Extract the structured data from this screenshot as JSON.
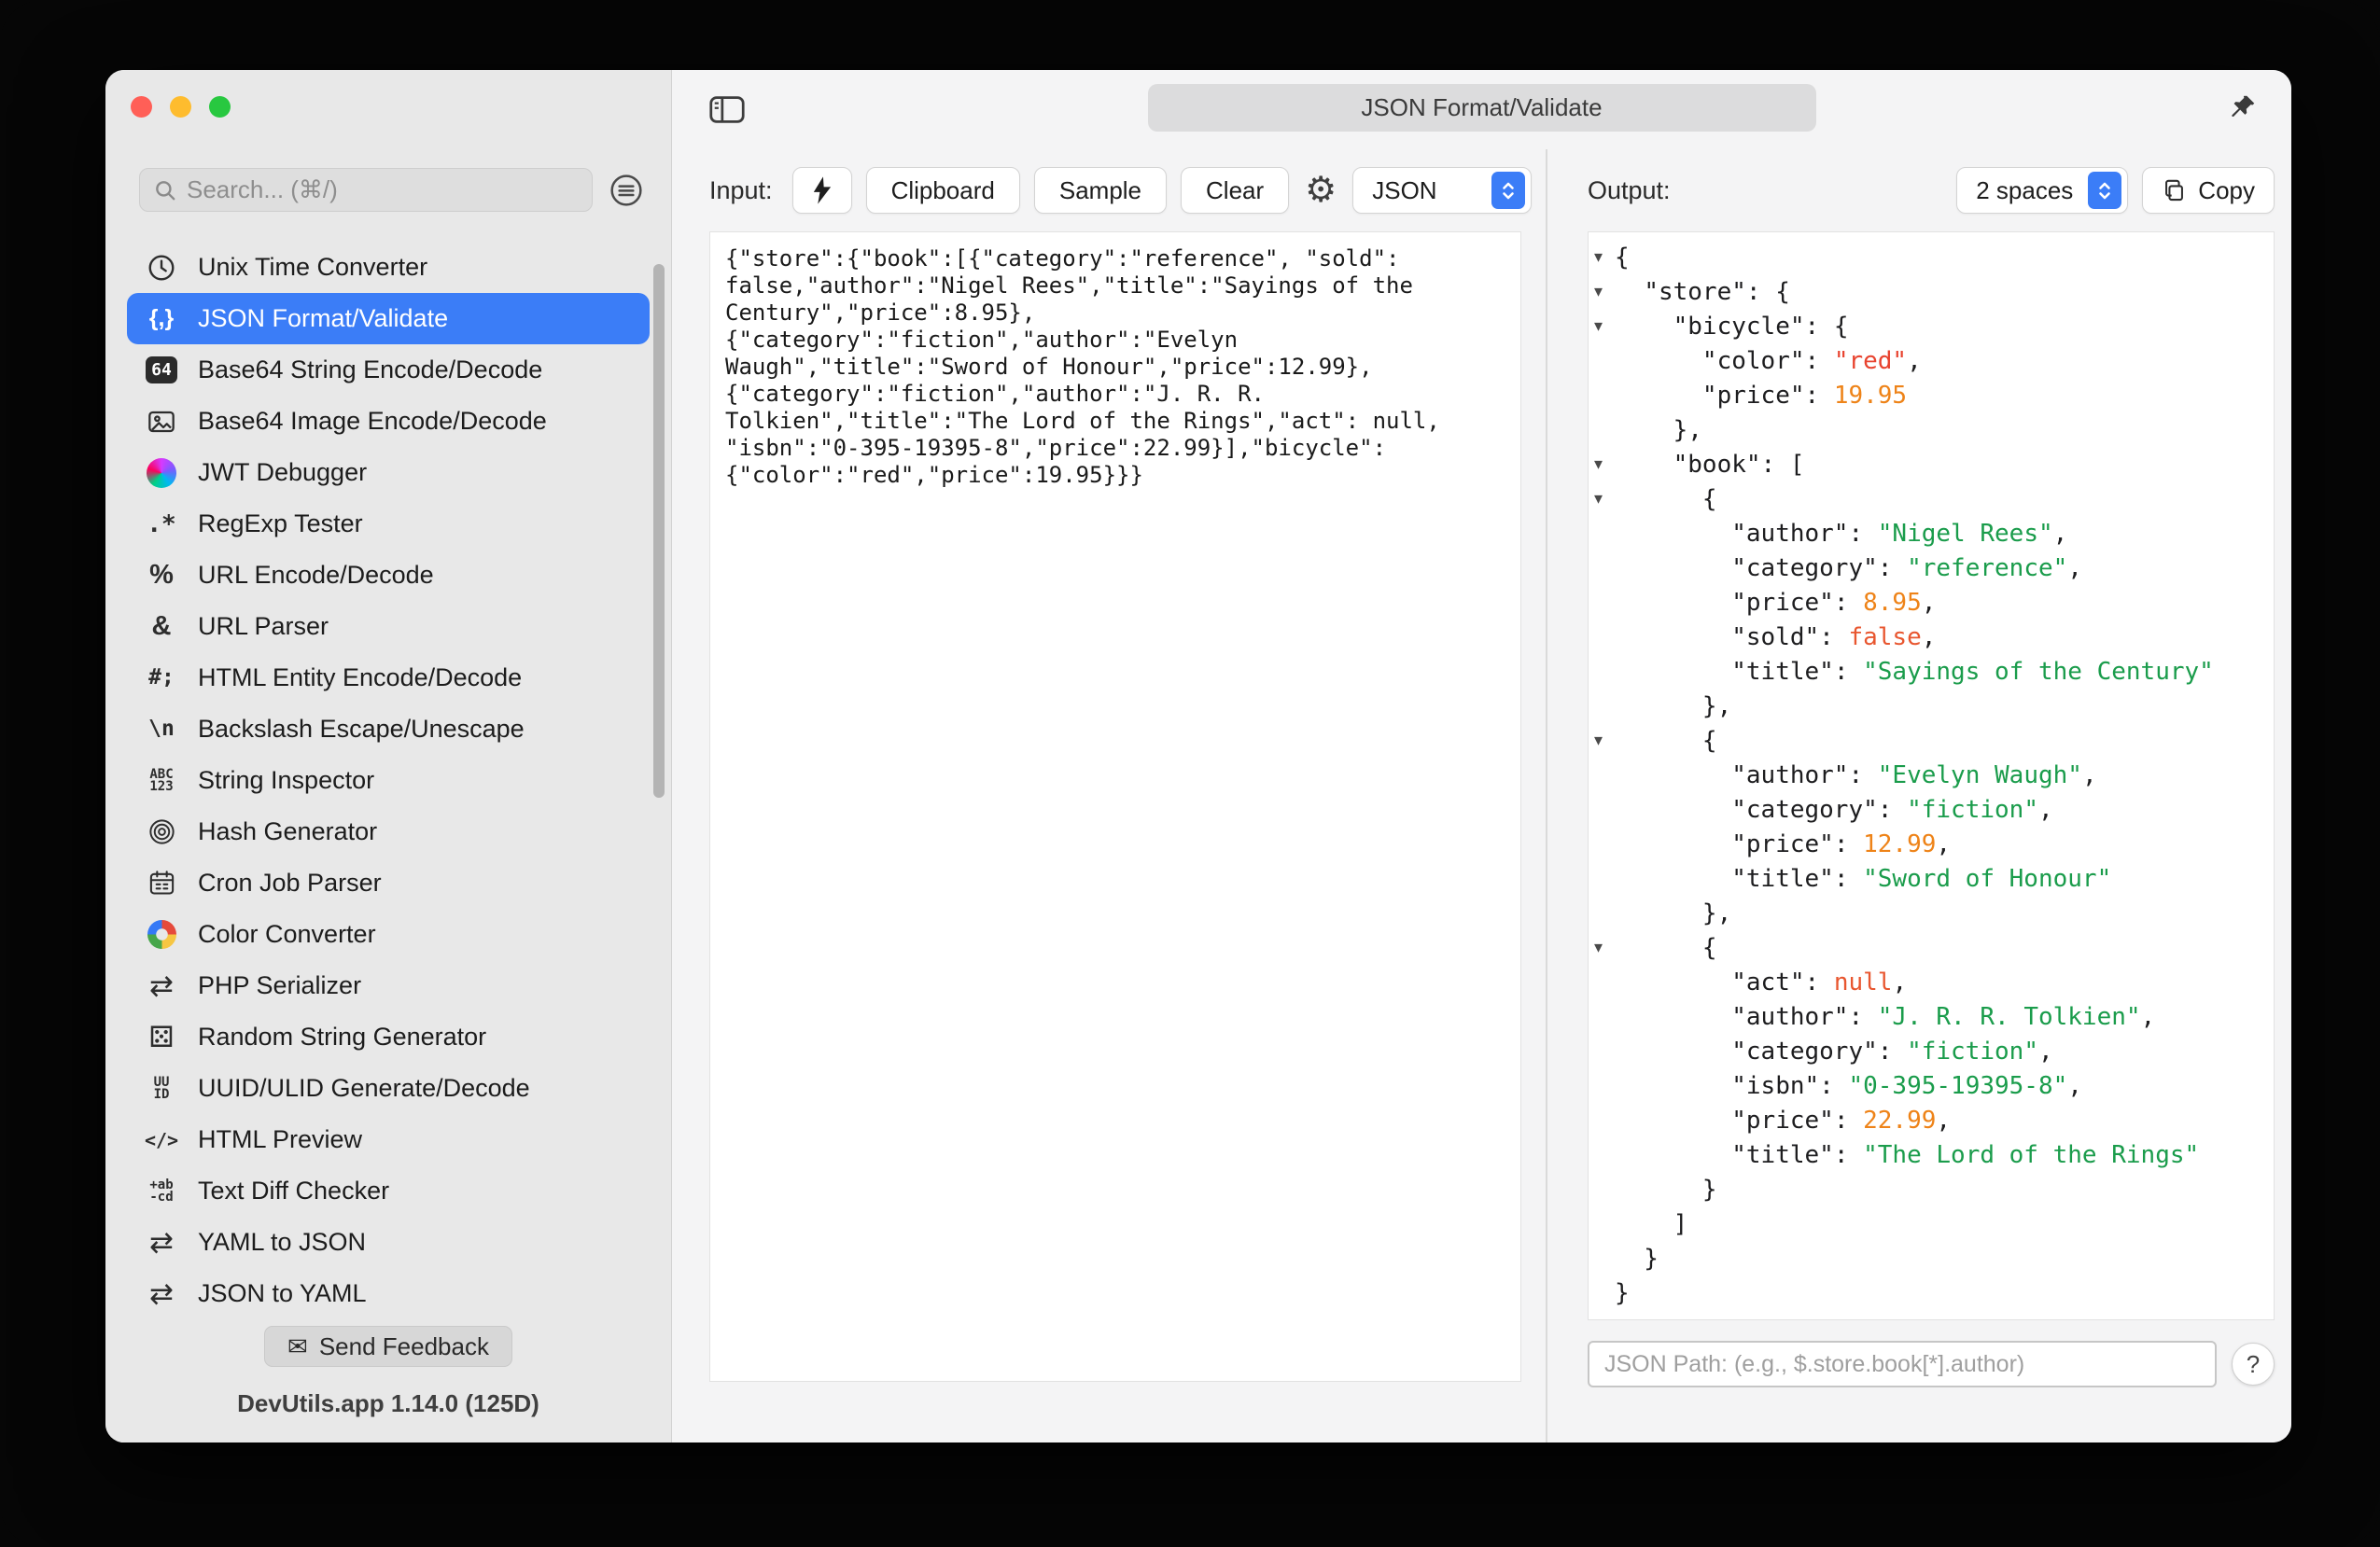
{
  "window": {
    "tab_title": "JSON Format/Validate"
  },
  "sidebar": {
    "search": {
      "placeholder": "Search... (⌘/)"
    },
    "items": [
      {
        "label": "Unix Time Converter",
        "icon": "clock",
        "selected": false
      },
      {
        "label": "JSON Format/Validate",
        "icon": "json-braces",
        "selected": true
      },
      {
        "label": "Base64 String Encode/Decode",
        "icon": "base64",
        "selected": false
      },
      {
        "label": "Base64 Image Encode/Decode",
        "icon": "image",
        "selected": false
      },
      {
        "label": "JWT Debugger",
        "icon": "jwt",
        "selected": false
      },
      {
        "label": "RegExp Tester",
        "icon": "regexp",
        "selected": false
      },
      {
        "label": "URL Encode/Decode",
        "icon": "percent",
        "selected": false
      },
      {
        "label": "URL Parser",
        "icon": "ampersand",
        "selected": false
      },
      {
        "label": "HTML Entity Encode/Decode",
        "icon": "entity",
        "selected": false
      },
      {
        "label": "Backslash Escape/Unescape",
        "icon": "backslash",
        "selected": false
      },
      {
        "label": "String Inspector",
        "icon": "string-inspector",
        "selected": false
      },
      {
        "label": "Hash Generator",
        "icon": "fingerprint",
        "selected": false
      },
      {
        "label": "Cron Job Parser",
        "icon": "calendar",
        "selected": false
      },
      {
        "label": "Color Converter",
        "icon": "palette",
        "selected": false
      },
      {
        "label": "PHP Serializer",
        "icon": "swap",
        "selected": false
      },
      {
        "label": "Random String Generator",
        "icon": "dice",
        "selected": false
      },
      {
        "label": "UUID/ULID Generate/Decode",
        "icon": "uuid",
        "selected": false
      },
      {
        "label": "HTML Preview",
        "icon": "code",
        "selected": false
      },
      {
        "label": "Text Diff Checker",
        "icon": "diff",
        "selected": false
      },
      {
        "label": "YAML to JSON",
        "icon": "swap",
        "selected": false
      },
      {
        "label": "JSON to YAML",
        "icon": "swap",
        "selected": false
      }
    ],
    "feedback_button": "Send Feedback",
    "version": "DevUtils.app 1.14.0 (125D)"
  },
  "input_panel": {
    "label": "Input:",
    "clipboard_button": "Clipboard",
    "sample_button": "Sample",
    "clear_button": "Clear",
    "format_select_value": "JSON",
    "content": "{\"store\":{\"book\":[{\"category\":\"reference\", \"sold\": false,\"author\":\"Nigel Rees\",\"title\":\"Sayings of the Century\",\"price\":8.95},\n{\"category\":\"fiction\",\"author\":\"Evelyn Waugh\",\"title\":\"Sword of Honour\",\"price\":12.99},\n{\"category\":\"fiction\",\"author\":\"J. R. R. Tolkien\",\"title\":\"The Lord of the Rings\",\"act\": null, \"isbn\":\"0-395-19395-8\",\"price\":22.99}],\"bicycle\":{\"color\":\"red\",\"price\":19.95}}}"
  },
  "output_panel": {
    "label": "Output:",
    "indent_select_value": "2 spaces",
    "copy_button": "Copy",
    "json_path_placeholder": "JSON Path: (e.g., $.store.book[*].author)",
    "help_button": "?",
    "lines": [
      {
        "f": true,
        "t": [
          [
            "p",
            "{"
          ]
        ]
      },
      {
        "f": true,
        "t": [
          [
            "p",
            "  "
          ],
          [
            "k",
            "\"store\""
          ],
          [
            "p",
            ": {"
          ]
        ]
      },
      {
        "f": true,
        "t": [
          [
            "p",
            "    "
          ],
          [
            "k",
            "\"bicycle\""
          ],
          [
            "p",
            ": {"
          ]
        ]
      },
      {
        "f": false,
        "t": [
          [
            "p",
            "      "
          ],
          [
            "k",
            "\"color\""
          ],
          [
            "p",
            ": "
          ],
          [
            "r",
            "\"red\""
          ],
          [
            "p",
            ","
          ]
        ]
      },
      {
        "f": false,
        "t": [
          [
            "p",
            "      "
          ],
          [
            "k",
            "\"price\""
          ],
          [
            "p",
            ": "
          ],
          [
            "n",
            "19.95"
          ]
        ]
      },
      {
        "f": false,
        "t": [
          [
            "p",
            "    },"
          ]
        ]
      },
      {
        "f": true,
        "t": [
          [
            "p",
            "    "
          ],
          [
            "k",
            "\"book\""
          ],
          [
            "p",
            ": ["
          ]
        ]
      },
      {
        "f": true,
        "t": [
          [
            "p",
            "      {"
          ]
        ]
      },
      {
        "f": false,
        "t": [
          [
            "p",
            "        "
          ],
          [
            "k",
            "\"author\""
          ],
          [
            "p",
            ": "
          ],
          [
            "s",
            "\"Nigel Rees\""
          ],
          [
            "p",
            ","
          ]
        ]
      },
      {
        "f": false,
        "t": [
          [
            "p",
            "        "
          ],
          [
            "k",
            "\"category\""
          ],
          [
            "p",
            ": "
          ],
          [
            "s",
            "\"reference\""
          ],
          [
            "p",
            ","
          ]
        ]
      },
      {
        "f": false,
        "t": [
          [
            "p",
            "        "
          ],
          [
            "k",
            "\"price\""
          ],
          [
            "p",
            ": "
          ],
          [
            "n",
            "8.95"
          ],
          [
            "p",
            ","
          ]
        ]
      },
      {
        "f": false,
        "t": [
          [
            "p",
            "        "
          ],
          [
            "k",
            "\"sold\""
          ],
          [
            "p",
            ": "
          ],
          [
            "b",
            "false"
          ],
          [
            "p",
            ","
          ]
        ]
      },
      {
        "f": false,
        "t": [
          [
            "p",
            "        "
          ],
          [
            "k",
            "\"title\""
          ],
          [
            "p",
            ": "
          ],
          [
            "s",
            "\"Sayings of the Century\""
          ]
        ]
      },
      {
        "f": false,
        "t": [
          [
            "p",
            "      },"
          ]
        ]
      },
      {
        "f": true,
        "t": [
          [
            "p",
            "      {"
          ]
        ]
      },
      {
        "f": false,
        "t": [
          [
            "p",
            "        "
          ],
          [
            "k",
            "\"author\""
          ],
          [
            "p",
            ": "
          ],
          [
            "s",
            "\"Evelyn Waugh\""
          ],
          [
            "p",
            ","
          ]
        ]
      },
      {
        "f": false,
        "t": [
          [
            "p",
            "        "
          ],
          [
            "k",
            "\"category\""
          ],
          [
            "p",
            ": "
          ],
          [
            "s",
            "\"fiction\""
          ],
          [
            "p",
            ","
          ]
        ]
      },
      {
        "f": false,
        "t": [
          [
            "p",
            "        "
          ],
          [
            "k",
            "\"price\""
          ],
          [
            "p",
            ": "
          ],
          [
            "n",
            "12.99"
          ],
          [
            "p",
            ","
          ]
        ]
      },
      {
        "f": false,
        "t": [
          [
            "p",
            "        "
          ],
          [
            "k",
            "\"title\""
          ],
          [
            "p",
            ": "
          ],
          [
            "s",
            "\"Sword of Honour\""
          ]
        ]
      },
      {
        "f": false,
        "t": [
          [
            "p",
            "      },"
          ]
        ]
      },
      {
        "f": true,
        "t": [
          [
            "p",
            "      {"
          ]
        ]
      },
      {
        "f": false,
        "t": [
          [
            "p",
            "        "
          ],
          [
            "k",
            "\"act\""
          ],
          [
            "p",
            ": "
          ],
          [
            "b",
            "null"
          ],
          [
            "p",
            ","
          ]
        ]
      },
      {
        "f": false,
        "t": [
          [
            "p",
            "        "
          ],
          [
            "k",
            "\"author\""
          ],
          [
            "p",
            ": "
          ],
          [
            "s",
            "\"J. R. R. Tolkien\""
          ],
          [
            "p",
            ","
          ]
        ]
      },
      {
        "f": false,
        "t": [
          [
            "p",
            "        "
          ],
          [
            "k",
            "\"category\""
          ],
          [
            "p",
            ": "
          ],
          [
            "s",
            "\"fiction\""
          ],
          [
            "p",
            ","
          ]
        ]
      },
      {
        "f": false,
        "t": [
          [
            "p",
            "        "
          ],
          [
            "k",
            "\"isbn\""
          ],
          [
            "p",
            ": "
          ],
          [
            "s",
            "\"0-395-19395-8\""
          ],
          [
            "p",
            ","
          ]
        ]
      },
      {
        "f": false,
        "t": [
          [
            "p",
            "        "
          ],
          [
            "k",
            "\"price\""
          ],
          [
            "p",
            ": "
          ],
          [
            "n",
            "22.99"
          ],
          [
            "p",
            ","
          ]
        ]
      },
      {
        "f": false,
        "t": [
          [
            "p",
            "        "
          ],
          [
            "k",
            "\"title\""
          ],
          [
            "p",
            ": "
          ],
          [
            "s",
            "\"The Lord of the Rings\""
          ]
        ]
      },
      {
        "f": false,
        "t": [
          [
            "p",
            "      }"
          ]
        ]
      },
      {
        "f": false,
        "t": [
          [
            "p",
            "    ]"
          ]
        ]
      },
      {
        "f": false,
        "t": [
          [
            "p",
            "  }"
          ]
        ]
      },
      {
        "f": false,
        "t": [
          [
            "p",
            "}"
          ]
        ]
      }
    ]
  },
  "colors": {
    "accent_blue": "#3b7df7",
    "string_green": "#1a9c4b",
    "number_orange": "#ee8318",
    "keyword_red": "#e8562f",
    "red_value": "#e8432f",
    "traffic_red": "#ff5f57",
    "traffic_yellow": "#febc2e",
    "traffic_green": "#28c840"
  }
}
